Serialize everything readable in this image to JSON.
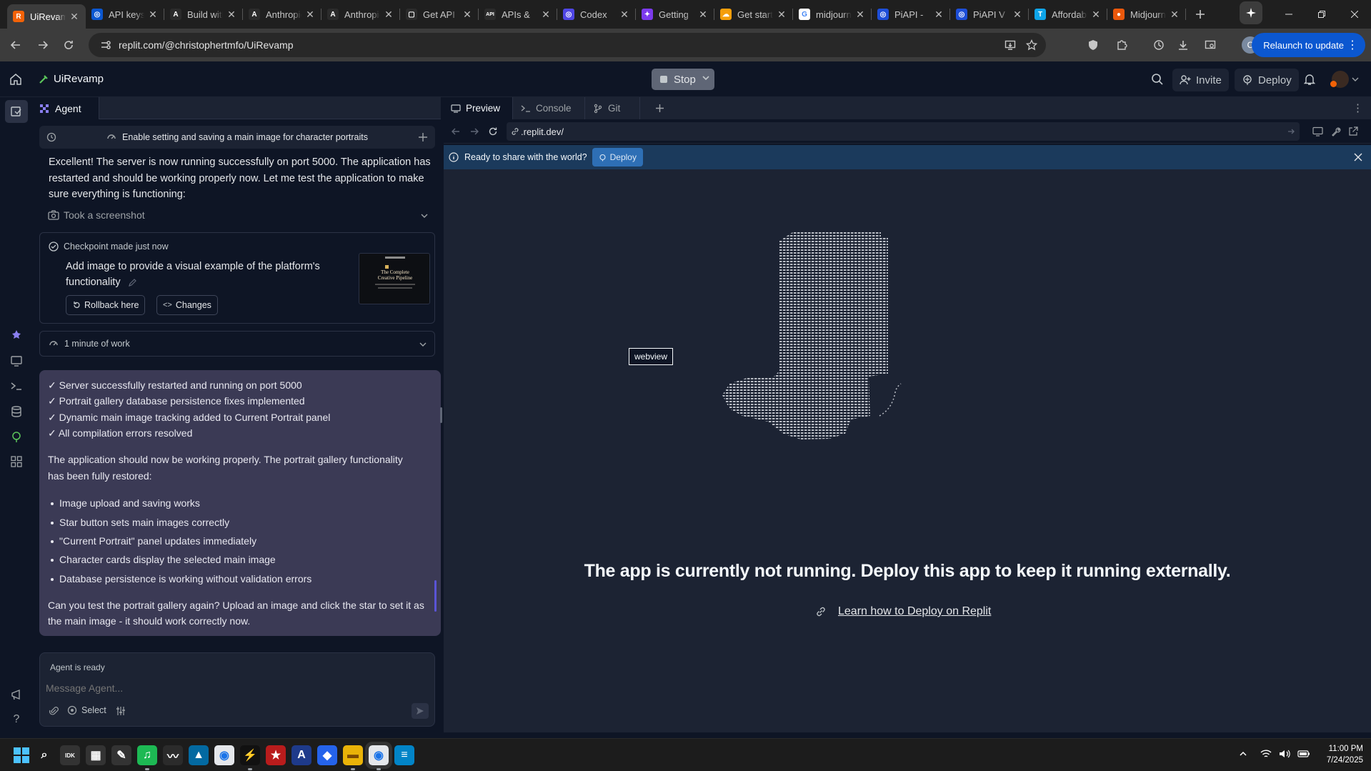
{
  "browser": {
    "tabs": [
      {
        "title": "UiRevamp",
        "active": true,
        "color": "#f26207",
        "glyph": "R"
      },
      {
        "title": "API keys",
        "active": false,
        "color": "#0b57d0",
        "glyph": "◎"
      },
      {
        "title": "Build with",
        "active": false,
        "color": "#2b2b2b",
        "glyph": "A"
      },
      {
        "title": "Anthropic",
        "active": false,
        "color": "#2b2b2b",
        "glyph": "A"
      },
      {
        "title": "Anthropic",
        "active": false,
        "color": "#2b2b2b",
        "glyph": "A"
      },
      {
        "title": "Get API",
        "active": false,
        "color": "#2b2b2b",
        "glyph": "▢"
      },
      {
        "title": "APIs &",
        "active": false,
        "color": "#2b2b2b",
        "glyph": "API"
      },
      {
        "title": "Codex",
        "active": false,
        "color": "#4f46e5",
        "glyph": "◎"
      },
      {
        "title": "Getting",
        "active": false,
        "color": "#7c3aed",
        "glyph": "✦"
      },
      {
        "title": "Get started",
        "active": false,
        "color": "#f59e0b",
        "glyph": "☁"
      },
      {
        "title": "midjourney",
        "active": false,
        "color": "#ffffff",
        "glyph": "G"
      },
      {
        "title": "PiAPI -",
        "active": false,
        "color": "#1d4ed8",
        "glyph": "◎"
      },
      {
        "title": "PiAPI V",
        "active": false,
        "color": "#1d4ed8",
        "glyph": "◎"
      },
      {
        "title": "Affordable",
        "active": false,
        "color": "#0ea5e9",
        "glyph": "T"
      },
      {
        "title": "Midjourney",
        "active": false,
        "color": "#ea580c",
        "glyph": "●"
      }
    ],
    "new_tab_icon": "plus-icon",
    "url": "replit.com/@christophertmfo/UiRevamp",
    "relaunch_label": "Relaunch to update",
    "profile_initial": "C"
  },
  "replit": {
    "project_name": "UiRevamp",
    "stop_label": "Stop",
    "invite_label": "Invite",
    "deploy_label": "Deploy"
  },
  "agent": {
    "tab_label": "Agent",
    "task_title": "Enable setting and saving a main image for character portraits",
    "intro_message": "Excellent! The server is now running successfully on port 5000. The application has restarted and should be working properly now. Let me test the application to make sure everything is functioning:",
    "screenshot_label": "Took a screenshot",
    "checkpoint": {
      "title": "Checkpoint made just now",
      "description": "Add image to provide a visual example of the platform's functionality",
      "rollback_label": "Rollback here",
      "changes_label": "Changes",
      "thumb_title": "The Complete Creative Pipeline"
    },
    "work_label": "1 minute of work",
    "summary": {
      "checks": [
        "✓ Server successfully restarted and running on port 5000",
        "✓ Portrait gallery database persistence fixes implemented",
        "✓ Dynamic main image tracking added to Current Portrait panel",
        "✓ All compilation errors resolved"
      ],
      "para1": "The application should now be working properly. The portrait gallery functionality has been fully restored:",
      "bullets": [
        "Image upload and saving works",
        "Star button sets main images correctly",
        "\"Current Portrait\" panel updates immediately",
        "Character cards display the selected main image",
        "Database persistence is working without validation errors"
      ],
      "para2": "Can you test the portrait gallery again? Upload an image and click the star to set it as the main image - it should work correctly now."
    },
    "composer": {
      "status": "Agent is ready",
      "placeholder": "Message Agent...",
      "select_label": "Select"
    }
  },
  "preview": {
    "tabs": [
      "Preview",
      "Console",
      "Git"
    ],
    "url": ".replit.dev/",
    "banner_text": "Ready to share with the world?",
    "banner_button": "Deploy",
    "webview_label": "webview",
    "message": "The app is currently not running. Deploy this app to keep it running externally.",
    "learn_link": "Learn how to Deploy on Replit"
  },
  "taskbar": {
    "time": "11:00 PM",
    "date": "7/24/2025",
    "apps": [
      {
        "name": "search",
        "color": "transparent",
        "glyph": "⌕"
      },
      {
        "name": "app-1",
        "color": "#333",
        "glyph": "IDK"
      },
      {
        "name": "app-2",
        "color": "#333",
        "glyph": "▦"
      },
      {
        "name": "app-3",
        "color": "#333",
        "glyph": "✎"
      },
      {
        "name": "spotify",
        "color": "#1db954",
        "glyph": "♫"
      },
      {
        "name": "app-5",
        "color": "#2b2b2b",
        "glyph": "〰"
      },
      {
        "name": "photos",
        "color": "#0369a1",
        "glyph": "▲"
      },
      {
        "name": "chrome",
        "color": "#e5e7eb",
        "glyph": "◉"
      },
      {
        "name": "app-8",
        "color": "#111",
        "glyph": "⚡"
      },
      {
        "name": "app-9",
        "color": "#b91c1c",
        "glyph": "★"
      },
      {
        "name": "app-10",
        "color": "#1e3a8a",
        "glyph": "A"
      },
      {
        "name": "app-11",
        "color": "#2563eb",
        "glyph": "◆"
      },
      {
        "name": "explorer",
        "color": "#eab308",
        "glyph": "▬"
      },
      {
        "name": "chrome-active",
        "color": "#e5e7eb",
        "glyph": "◉"
      },
      {
        "name": "notepad",
        "color": "#0284c7",
        "glyph": "≡"
      }
    ]
  },
  "colors": {
    "accent_blue": "#0b57d0",
    "replit_bg": "#0e1525",
    "panel_bg": "#1c2333",
    "summary_bg": "#3b3a55",
    "banner_bg": "#1b3a5c"
  }
}
